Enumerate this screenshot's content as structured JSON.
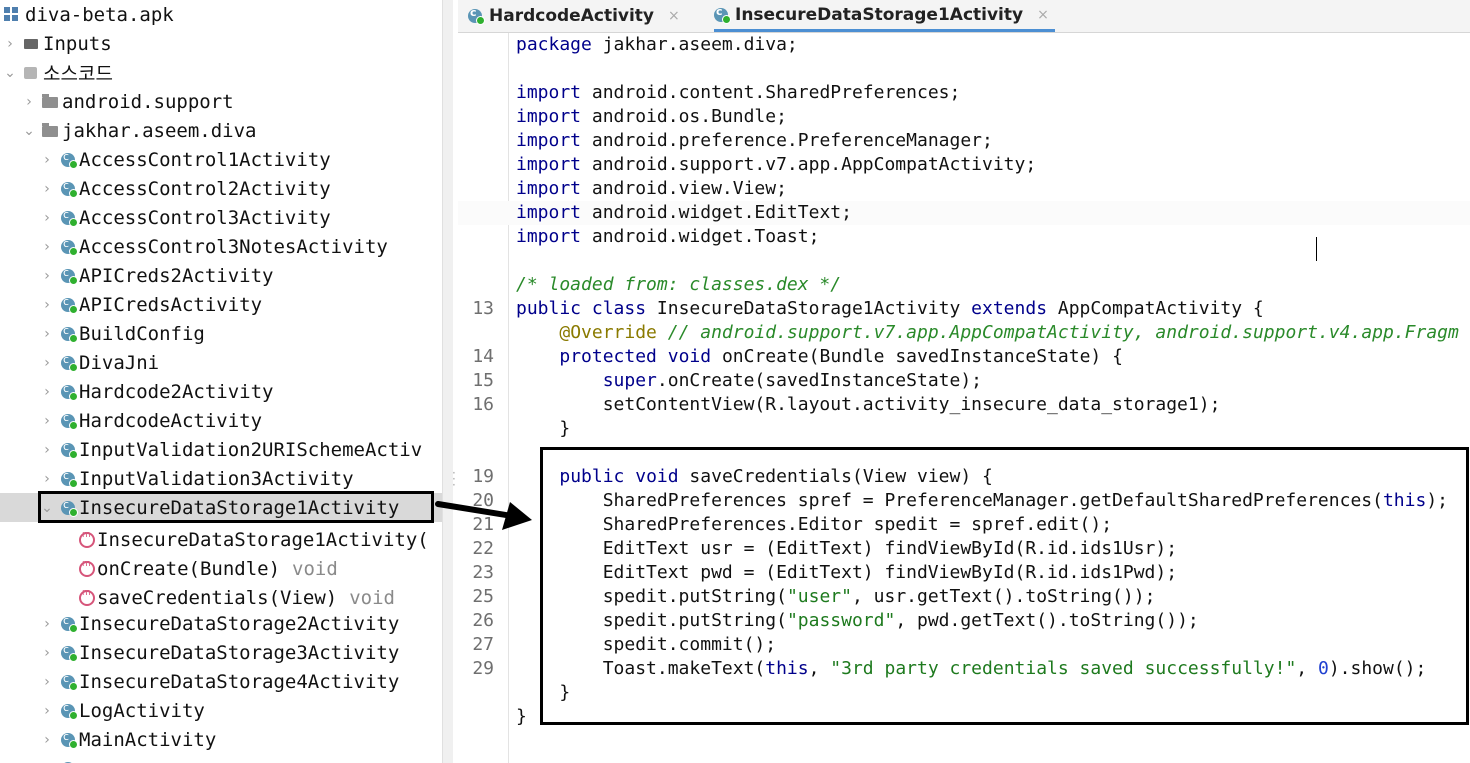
{
  "tree": {
    "root": "diva-beta.apk",
    "inputs": "Inputs",
    "source": "소스코드",
    "pkg_support": "android.support",
    "pkg_diva": "jakhar.aseem.diva",
    "classes": [
      "AccessControl1Activity",
      "AccessControl2Activity",
      "AccessControl3Activity",
      "AccessControl3NotesActivity",
      "APICreds2Activity",
      "APICredsActivity",
      "BuildConfig",
      "DivaJni",
      "Hardcode2Activity",
      "HardcodeActivity",
      "InputValidation2URISchemeActiv",
      "InputValidation3Activity",
      "InsecureDataStorage1Activity"
    ],
    "methods": [
      {
        "name": "InsecureDataStorage1Activity(",
        "type": ""
      },
      {
        "name": "onCreate(Bundle)",
        "type": "void"
      },
      {
        "name": "saveCredentials(View)",
        "type": "void"
      }
    ],
    "classes_after": [
      "InsecureDataStorage2Activity",
      "InsecureDataStorage3Activity",
      "InsecureDataStorage4Activity",
      "LogActivity",
      "MainActivity"
    ]
  },
  "tabs": [
    {
      "label": "HardcodeActivity",
      "active": false
    },
    {
      "label": "InsecureDataStorage1Activity",
      "active": true
    }
  ],
  "code_lines": [
    {
      "ln": "",
      "text": "package jakhar.aseem.diva;"
    },
    {
      "ln": "",
      "text": ""
    },
    {
      "ln": "",
      "text": "import android.content.SharedPreferences;"
    },
    {
      "ln": "",
      "text": "import android.os.Bundle;"
    },
    {
      "ln": "",
      "text": "import android.preference.PreferenceManager;"
    },
    {
      "ln": "",
      "text": "import android.support.v7.app.AppCompatActivity;"
    },
    {
      "ln": "",
      "text": "import android.view.View;"
    },
    {
      "ln": "",
      "text": "import android.widget.EditText;"
    },
    {
      "ln": "",
      "text": "import android.widget.Toast;"
    },
    {
      "ln": "",
      "text": ""
    },
    {
      "ln": "",
      "text": "/* loaded from: classes.dex */"
    },
    {
      "ln": "13",
      "text": "public class InsecureDataStorage1Activity extends AppCompatActivity {"
    },
    {
      "ln": "",
      "text": "    @Override // android.support.v7.app.AppCompatActivity, android.support.v4.app.Fragm"
    },
    {
      "ln": "14",
      "text": "    protected void onCreate(Bundle savedInstanceState) {"
    },
    {
      "ln": "15",
      "text": "        super.onCreate(savedInstanceState);"
    },
    {
      "ln": "16",
      "text": "        setContentView(R.layout.activity_insecure_data_storage1);"
    },
    {
      "ln": "",
      "text": "    }"
    },
    {
      "ln": "",
      "text": ""
    },
    {
      "ln": "19",
      "text": "    public void saveCredentials(View view) {"
    },
    {
      "ln": "20",
      "text": "        SharedPreferences spref = PreferenceManager.getDefaultSharedPreferences(this);"
    },
    {
      "ln": "21",
      "text": "        SharedPreferences.Editor spedit = spref.edit();"
    },
    {
      "ln": "22",
      "text": "        EditText usr = (EditText) findViewById(R.id.ids1Usr);"
    },
    {
      "ln": "23",
      "text": "        EditText pwd = (EditText) findViewById(R.id.ids1Pwd);"
    },
    {
      "ln": "25",
      "text": "        spedit.putString(\"user\", usr.getText().toString());"
    },
    {
      "ln": "26",
      "text": "        spedit.putString(\"password\", pwd.getText().toString());"
    },
    {
      "ln": "27",
      "text": "        spedit.commit();"
    },
    {
      "ln": "29",
      "text": "        Toast.makeText(this, \"3rd party credentials saved successfully!\", 0).show();"
    },
    {
      "ln": "",
      "text": "    }"
    },
    {
      "ln": "",
      "text": "}"
    }
  ],
  "colors": {
    "keyword": "#00008b",
    "comment": "#2a8a2a",
    "annotation": "#8a7a00",
    "string": "#1e7a1e",
    "number": "#1e3fd0",
    "tab_accent": "#4c8fd3"
  }
}
